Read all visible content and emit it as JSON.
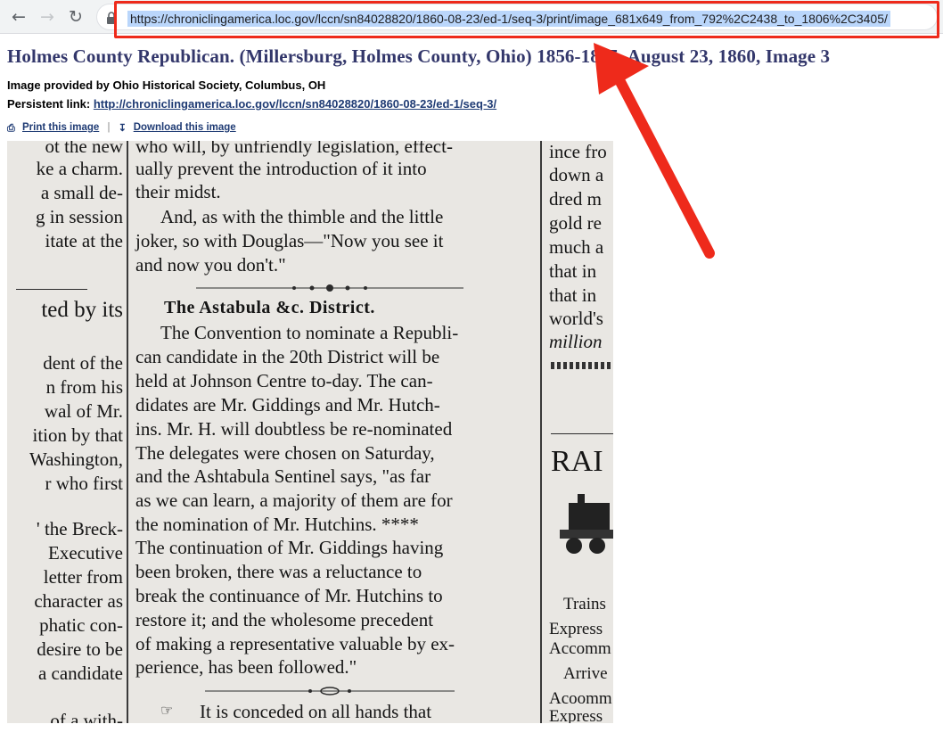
{
  "browser": {
    "url": "https://chroniclingamerica.loc.gov/lccn/sn84028820/1860-08-23/ed-1/seq-3/print/image_681x649_from_792%2C2438_to_1806%2C3405/"
  },
  "page": {
    "title": "Holmes County Republican. (Millersburg, Holmes County, Ohio) 1856-1865, August 23, 1860, Image 3",
    "provider": "Image provided by Ohio Historical Society, Columbus, OH",
    "persistent_label": "Persistent link:",
    "persistent_url": "http://chroniclingamerica.loc.gov/lccn/sn84028820/1860-08-23/ed-1/seq-3/",
    "print_label": "Print this image",
    "download_label": "Download this image",
    "separator": "|"
  },
  "scan": {
    "left_column": [
      "ot the new",
      "ke a charm.",
      "a small de-",
      "g in session",
      "itate at the",
      "ted by its",
      "dent of the",
      "n from his",
      "wal of Mr.",
      "ition by that",
      "Washington,",
      "r who first",
      "' the Breck-",
      "Executive",
      "letter from",
      "character as",
      "phatic con-",
      "desire to be",
      "a candidate",
      "of a with-"
    ],
    "middle_column": [
      "who will, by unfriendly legislation, effect-",
      "ually prevent the introduction of it into",
      "their midst.",
      "And, as with the thimble and the little",
      "joker, so with Douglas—\"Now you see it",
      "and now you don't.\"",
      "The Astabula &c. District.",
      "The Convention to nominate a Republi-",
      "can candidate in the 20th District will be",
      "held at Johnson Centre to-day. The can-",
      "didates are Mr. Giddings and Mr. Hutch-",
      "ins. Mr. H. will doubtless be re-nominated",
      "The delegates were chosen on Saturday,",
      "and the Ashtabula Sentinel says, \"as far",
      "as we can learn, a majority of them are for",
      "the nomination of Mr. Hutchins. ****",
      "The continuation of Mr. Giddings having",
      "been broken, there was a reluctance to",
      "break the continuance of Mr. Hutchins to",
      "restore it; and the wholesome precedent",
      "of making a representative valuable by ex-",
      "perience, has been followed.\"",
      "It is conceded on all hands that"
    ],
    "right_column": [
      "ince fro",
      "down a",
      "dred m",
      "gold re",
      "much a",
      "that in",
      "that in",
      "world's",
      "million",
      "RAI",
      "Trains",
      "Express",
      "Accomm",
      "Arrive",
      "Acoomm",
      "Express"
    ]
  },
  "colors": {
    "title": "#33376b",
    "link": "#1f3b74",
    "annotation": "#ee2a1b",
    "url_selection": "#bad6fb"
  }
}
